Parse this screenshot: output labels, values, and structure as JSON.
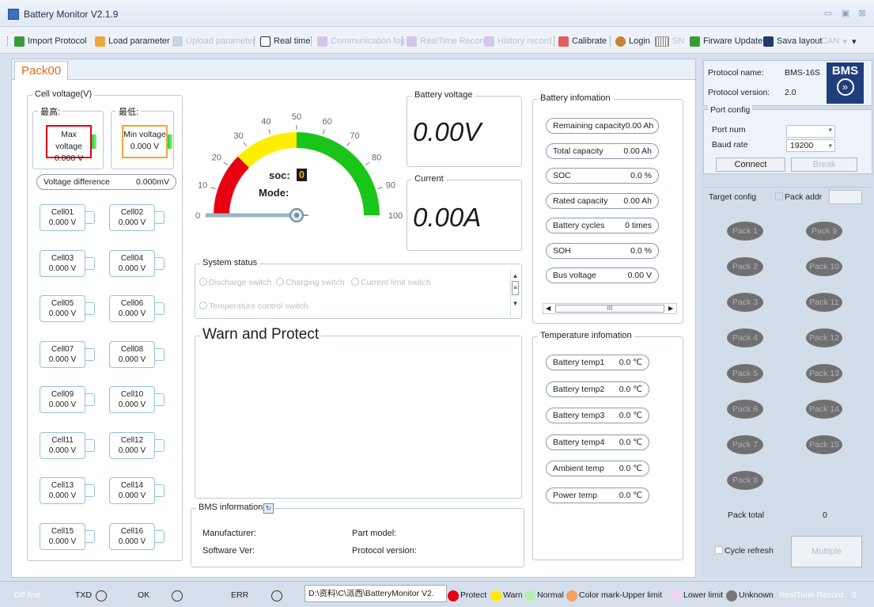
{
  "app": {
    "title": "Battery Monitor V2.1.9"
  },
  "toolbar": {
    "import": "Import Protocol",
    "load": "Load parameter",
    "upload": "Upload parameter",
    "realtime": "Real time",
    "comm_log": "Communication log",
    "rt_record": "RealTime Record",
    "history": "History record",
    "calibrate": "Calibrate",
    "login": "Login",
    "sn": "SN",
    "firmware": "Firware Update",
    "save_layout": "Sava layout",
    "can": "CAN"
  },
  "tab": {
    "label": "Pack00"
  },
  "cell_voltage": {
    "title": "Cell voltage(V)",
    "highest_label": "最高:",
    "lowest_label": "最低:",
    "max_label": "Max voltage",
    "max_value": "0.000 V",
    "min_label": "Min voltage",
    "min_value": "0.000 V",
    "diff_label": "Voltage difference",
    "diff_value": "0.000mV",
    "cells": [
      {
        "name": "Cell01",
        "value": "0.000 V"
      },
      {
        "name": "Cell02",
        "value": "0.000 V"
      },
      {
        "name": "Cell03",
        "value": "0.000 V"
      },
      {
        "name": "Cell04",
        "value": "0.000 V"
      },
      {
        "name": "Cell05",
        "value": "0.000 V"
      },
      {
        "name": "Cell06",
        "value": "0.000 V"
      },
      {
        "name": "Cell07",
        "value": "0.000 V"
      },
      {
        "name": "Cell08",
        "value": "0.000 V"
      },
      {
        "name": "Cell09",
        "value": "0.000 V"
      },
      {
        "name": "Cell10",
        "value": "0.000 V"
      },
      {
        "name": "Cell11",
        "value": "0.000 V"
      },
      {
        "name": "Cell12",
        "value": "0.000 V"
      },
      {
        "name": "Cell13",
        "value": "0.000 V"
      },
      {
        "name": "Cell14",
        "value": "0.000 V"
      },
      {
        "name": "Cell15",
        "value": "0.000 V"
      },
      {
        "name": "Cell16",
        "value": "0.000 V"
      }
    ]
  },
  "gauge": {
    "ticks": [
      "0",
      "10",
      "20",
      "30",
      "40",
      "50",
      "60",
      "70",
      "80",
      "90",
      "100"
    ],
    "soc_label": "soc:",
    "soc_value": "0",
    "mode_label": "Mode:",
    "needle_value": 0
  },
  "battery_voltage": {
    "title": "Battery voltage",
    "value": "0.00V"
  },
  "current": {
    "title": "Current",
    "value": "0.00A"
  },
  "system_status": {
    "title": "System status",
    "options": [
      "Discharge switch",
      "Charging switch",
      "Current limit switch",
      "Temperature control switch"
    ]
  },
  "warn": {
    "title": "Warn and Protect"
  },
  "bms_info": {
    "title": "BMS information",
    "manufacturer": "Manufacturer:",
    "part_model": "Part model:",
    "software_ver": "Software Ver:",
    "protocol_version": "Protocol version:"
  },
  "battery_info": {
    "title": "Battery infomation",
    "items": [
      {
        "label": "Remaining capacity",
        "value": "0.00 Ah"
      },
      {
        "label": "Total capacity",
        "value": "0.00 Ah"
      },
      {
        "label": "SOC",
        "value": "0.0 %"
      },
      {
        "label": "Rated capacity",
        "value": "0.00 Ah"
      },
      {
        "label": "Battery cycles",
        "value": "0 times"
      },
      {
        "label": "SOH",
        "value": "0.0 %"
      },
      {
        "label": "Bus voltage",
        "value": "0.00 V"
      }
    ],
    "scroll_grip": "III"
  },
  "temp_info": {
    "title": "Temperature infomation",
    "items": [
      {
        "label": "Battery temp1",
        "value": "0.0 ℃"
      },
      {
        "label": "Battery temp2",
        "value": "0.0 ℃"
      },
      {
        "label": "Battery temp3",
        "value": "0.0 ℃"
      },
      {
        "label": "Battery temp4",
        "value": "0.0 ℃"
      },
      {
        "label": "Ambient temp",
        "value": "0.0 ℃"
      },
      {
        "label": "Power temp",
        "value": "0.0 ℃"
      }
    ]
  },
  "right": {
    "protocol_name_label": "Protocol name:",
    "protocol_name": "BMS-16S",
    "protocol_version_label": "Protocol version:",
    "protocol_version": "2.0",
    "logo": "BMS",
    "logo_arrow": "»",
    "port_config": "Port config",
    "port_num": "Port num",
    "baud_rate": "Baud rate",
    "baud_value": "19200",
    "connect": "Connect",
    "break": "Break",
    "target_config": "Target config",
    "pack_addr": "Pack addr",
    "packs": [
      "Pack 1",
      "Pack 9",
      "Pack 2",
      "Pack 10",
      "Pack 3",
      "Pack 11",
      "Pack 4",
      "Pack 12",
      "Pack 5",
      "Pack 13",
      "Pack 6",
      "Pack 14",
      "Pack 7",
      "Pack 15",
      "Pack 8"
    ],
    "pack_total_label": "Pack total",
    "pack_total": "0",
    "cycle_refresh": "Cycle refresh",
    "multiple": "Multiple"
  },
  "status": {
    "offline": "Off line",
    "txd": "TXD",
    "ok": "OK",
    "err": "ERR",
    "path": "D:\\资料\\C\\派西\\BatteryMonitor V2.",
    "protect": "Protect",
    "warn": "Warn",
    "normal": "Normal",
    "color_mark": "Color mark-Upper limit",
    "lower": "Lower limit",
    "unknown": "Unknown",
    "rt_record": "RealTime Record",
    "rt_count": "0"
  },
  "colors": {
    "protect": "#e60012",
    "warn": "#ffea00",
    "normal": "#b6f0b0",
    "upper": "#f5a05c",
    "lower": "#f3d3f3",
    "unknown": "#777777",
    "gauge_red": "#e60012",
    "gauge_yellow": "#ffee00",
    "gauge_green": "#19c519"
  }
}
